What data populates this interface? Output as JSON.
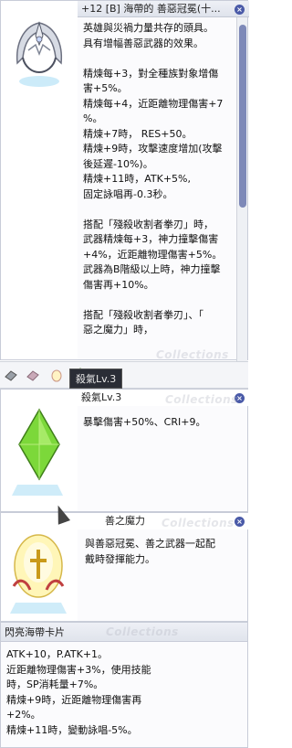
{
  "item_panel": {
    "title": "+12 [B] 海帶的 善惡冠冕(十...",
    "lines": [
      "英雄與災禍力量共存的頭具。",
      "具有增幅善惡武器的效果。",
      "",
      "精煉每+3，對全種族對象增傷",
      "害+5%。",
      "精煉每+4，近距離物理傷害+7",
      "%。",
      "精煉+7時， RES+50。",
      "精煉+9時，攻擊速度增加(攻擊",
      "後延遲-10%)。",
      "精煉+11時，ATK+5%,",
      "固定詠唱再-0.3秒。",
      "",
      "搭配「殘殺收割者拳刃」時，",
      "武器精煉每+3，神力撞擊傷害",
      "+4%，近距離物理傷害+5%。",
      "武器為B階級以上時，神力撞擊",
      "傷害再+10%。",
      "",
      "搭配「殘殺收割者拳刃」、「",
      "惡之魔力」時，"
    ],
    "tooltip": "殺氣Lv.3"
  },
  "tabs": [
    {
      "name": "book-tab"
    },
    {
      "name": "card-tab"
    },
    {
      "name": "egg-tab"
    },
    {
      "name": "gem-tab"
    }
  ],
  "gem_panel": {
    "title": "殺氣Lv.3",
    "lines": [
      "暴擊傷害+50%、CRI+9。"
    ]
  },
  "egg_panel": {
    "title": "善之魔力",
    "lines": [
      "與善惡冠冕、善之武器一起配",
      "戴時發揮能力。"
    ]
  },
  "card_panel": {
    "title": "閃亮海帶卡片",
    "lines": [
      "ATK+10，P.ATK+1。",
      "近距離物理傷害+3%，使用技能",
      "時，SP消耗量+7%。",
      "精煉+9時，近距離物理傷害再",
      "+2%。",
      "精煉+11時，變動詠唱-5%。"
    ]
  },
  "watermark_text": "Collections",
  "colors": {
    "accent": "#4a5aa8",
    "panel_bg": "#fbfbfd",
    "border": "#c8ccd8"
  }
}
